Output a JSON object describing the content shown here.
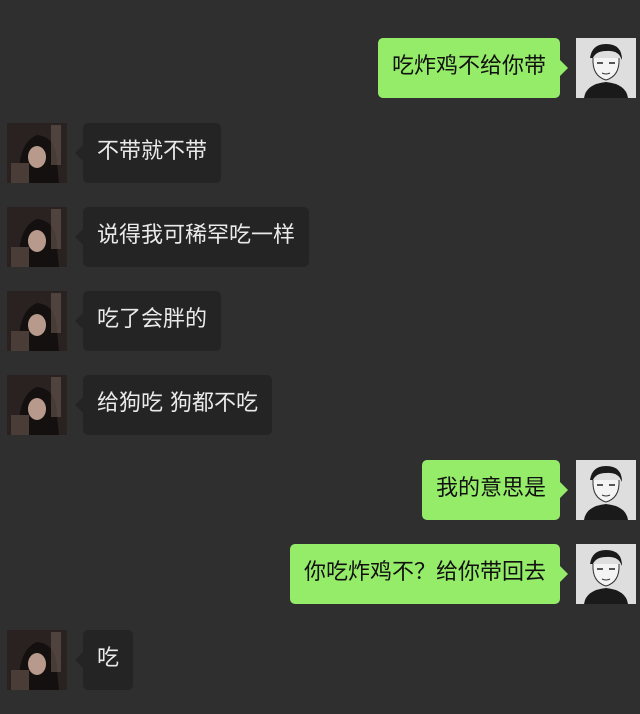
{
  "messages": [
    {
      "side": "right",
      "text": "吃炸鸡不给你带"
    },
    {
      "side": "left",
      "text": "不带就不带"
    },
    {
      "side": "left",
      "text": "说得我可稀罕吃一样"
    },
    {
      "side": "left",
      "text": "吃了会胖的"
    },
    {
      "side": "left",
      "text": "给狗吃 狗都不吃"
    },
    {
      "side": "right",
      "text": "我的意思是"
    },
    {
      "side": "right",
      "text": "你吃炸鸡不？给你带回去"
    },
    {
      "side": "left",
      "text": "吃"
    }
  ],
  "colors": {
    "background": "#2f2f2f",
    "sent_bubble": "#95ec69",
    "received_bubble": "#242424",
    "received_text": "#eaeaea"
  },
  "icons": {
    "sender_avatar": "male-sketch-avatar",
    "receiver_avatar": "female-photo-avatar"
  }
}
